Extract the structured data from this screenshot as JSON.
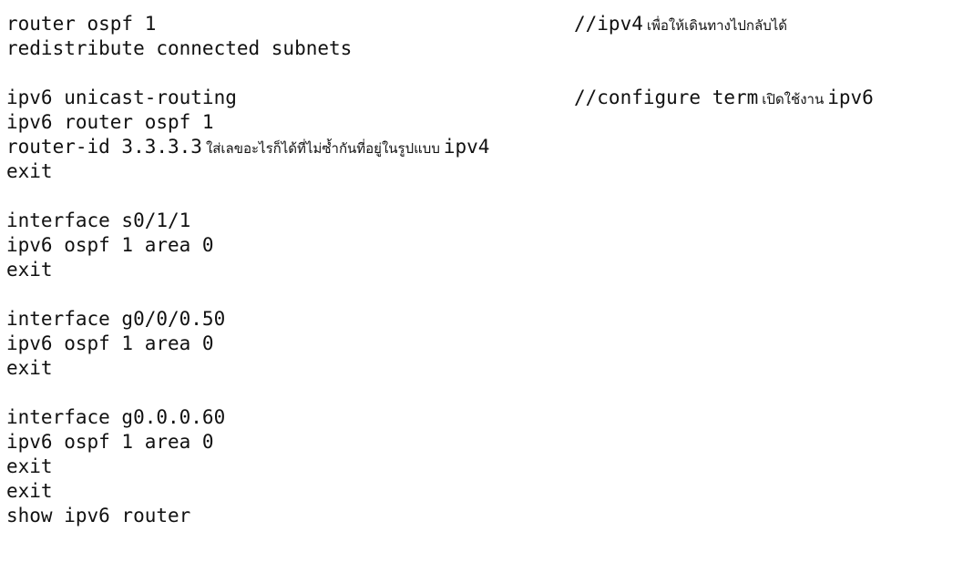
{
  "document": {
    "lines": [
      {
        "code": "router ospf 1"
      },
      {
        "code": "redistribute connected subnets"
      },
      {
        "code": ""
      },
      {
        "code": "ipv6 unicast-routing"
      },
      {
        "code": "ipv6 router ospf 1"
      },
      {
        "code": "router-id 3.3.3.3",
        "note": "ใส่เลขอะไรก็ได้ที่ไม่ซ้ำกันที่อยู่ในรูปแบบ",
        "note_code": "ipv4"
      },
      {
        "code": "exit"
      },
      {
        "code": ""
      },
      {
        "code": "interface s0/1/1"
      },
      {
        "code": "ipv6 ospf 1 area 0"
      },
      {
        "code": "exit"
      },
      {
        "code": ""
      },
      {
        "code": "interface g0/0/0.50"
      },
      {
        "code": "ipv6 ospf 1 area 0"
      },
      {
        "code": "exit"
      },
      {
        "code": ""
      },
      {
        "code": "interface g0.0.0.60"
      },
      {
        "code": "ipv6 ospf 1 area 0"
      },
      {
        "code": "exit"
      },
      {
        "code": "exit"
      },
      {
        "code": "show ipv6 router"
      }
    ],
    "comments": [
      {
        "code": "//ipv4",
        "note": "เพื่อให้เดินทางไปกลับได้"
      },
      {
        "code": "//configure term",
        "note": "เปิดใช้งาน",
        "code2": "ipv6"
      }
    ]
  }
}
